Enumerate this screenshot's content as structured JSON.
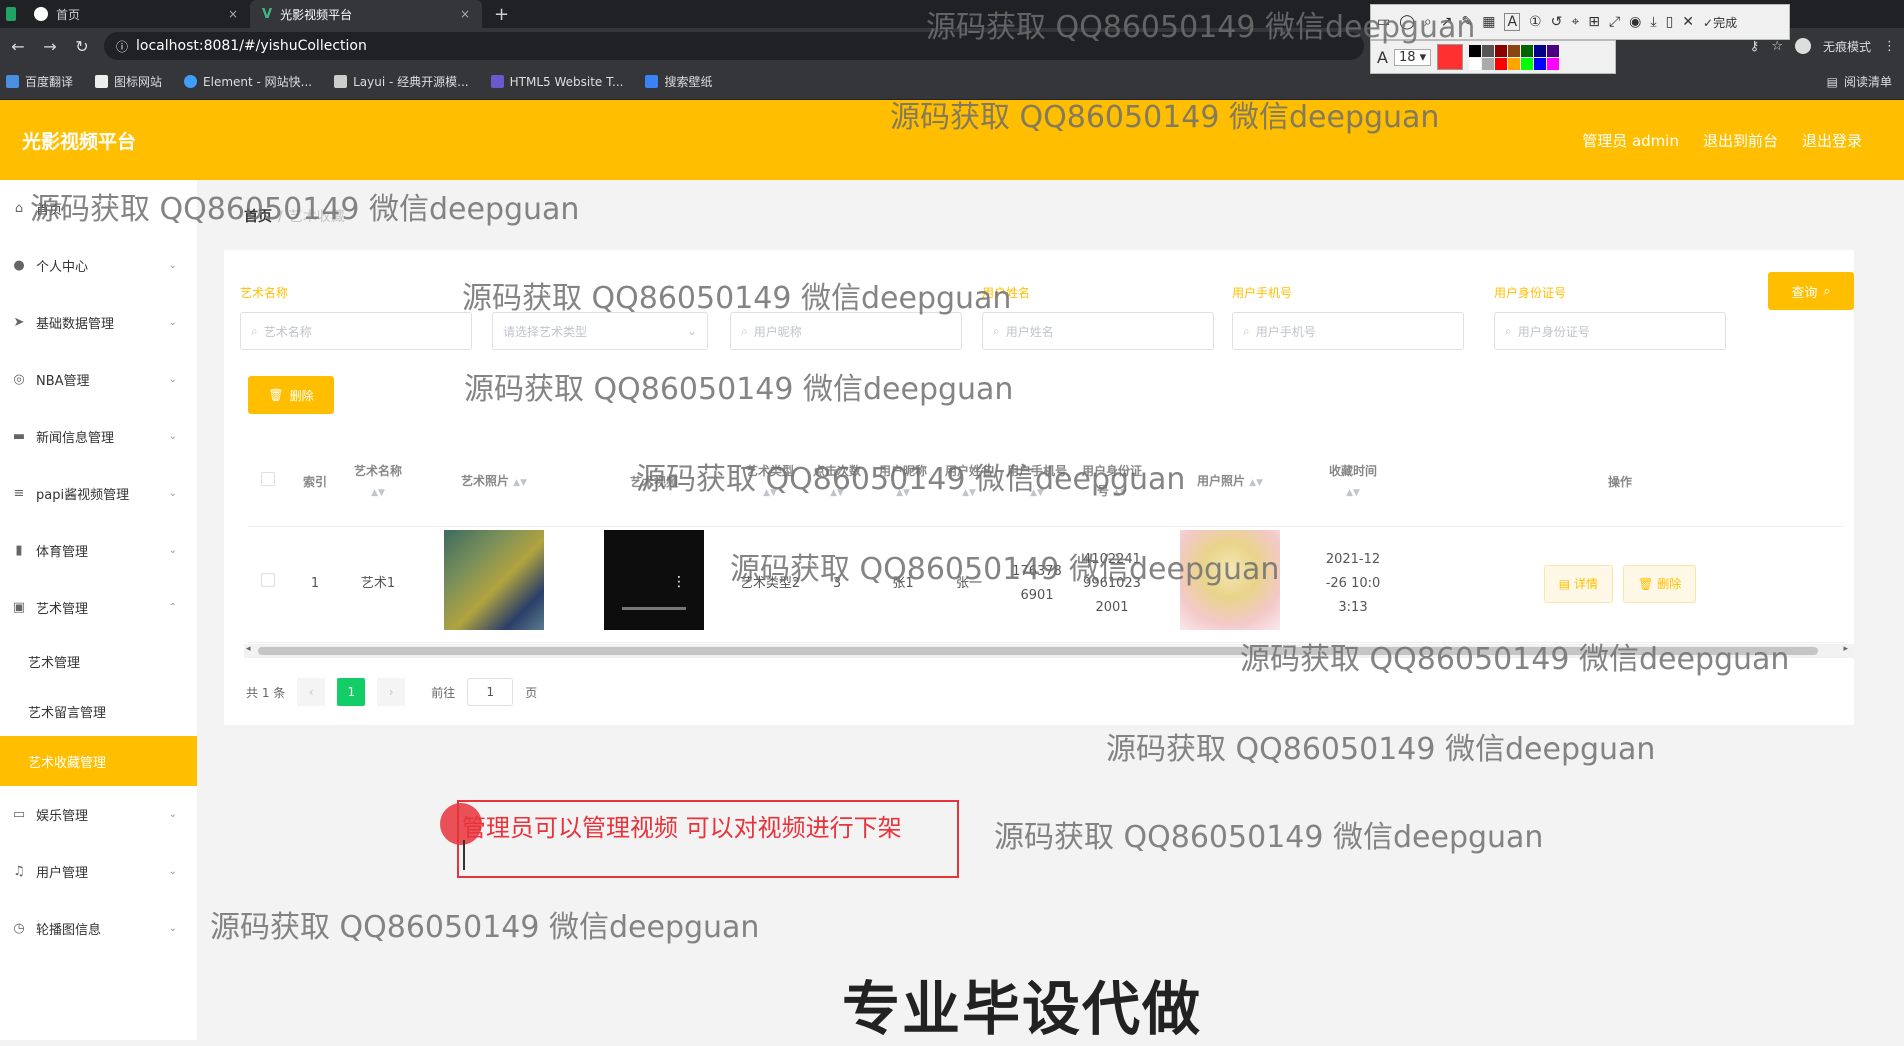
{
  "browser": {
    "tabs": [
      {
        "label": "首页",
        "close": "×"
      },
      {
        "label": "光影视频平台",
        "close": "×"
      }
    ],
    "new_tab": "+",
    "url": "localhost:8081/#/yishuCollection",
    "incognito_label": "无痕模式",
    "bookmarks": [
      "百度翻译",
      "图标网站",
      "Element - 网站快...",
      "Layui - 经典开源模...",
      "HTML5 Website T...",
      "搜索壁纸"
    ],
    "reading_list": "阅读清单"
  },
  "annotation_tool": {
    "font_size": "18",
    "done_label": "完成",
    "current_color": "#ff3030",
    "swatch_colors": [
      "#000000",
      "#555555",
      "#8b0000",
      "#8b4513",
      "#006400",
      "#00008b",
      "#4b0082",
      "#ffffff",
      "#aaaaaa",
      "#ff0000",
      "#ffa500",
      "#00ff00",
      "#0000ff",
      "#ff00ff",
      "#ffff00",
      "#00ffff"
    ]
  },
  "app": {
    "title": "光影视频平台",
    "nav": [
      "管理员 admin",
      "退出到前台",
      "退出登录"
    ],
    "accent": "#ffbf00"
  },
  "sidebar": {
    "items": [
      {
        "label": "首页",
        "icon": "home-icon"
      },
      {
        "label": "个人中心",
        "icon": "user-icon"
      },
      {
        "label": "基础数据管理",
        "icon": "send-icon"
      },
      {
        "label": "NBA管理",
        "icon": "circle-icon"
      },
      {
        "label": "新闻信息管理",
        "icon": "chat-icon"
      },
      {
        "label": "papi酱视频管理",
        "icon": "menu-icon"
      },
      {
        "label": "体育管理",
        "icon": "bar-icon"
      },
      {
        "label": "艺术管理",
        "icon": "box-icon"
      }
    ],
    "sub_items": [
      "艺术管理",
      "艺术留言管理",
      "艺术收藏管理"
    ],
    "items_after": [
      {
        "label": "娱乐管理",
        "icon": "chat-icon"
      },
      {
        "label": "用户管理",
        "icon": "mic-icon"
      },
      {
        "label": "轮播图信息",
        "icon": "clock-icon"
      }
    ]
  },
  "breadcrumb": {
    "home": "首页",
    "sep": "/",
    "current": "艺术收藏"
  },
  "filters": [
    {
      "label": "艺术名称",
      "placeholder": "艺术名称"
    },
    {
      "label": "",
      "placeholder": "请选择艺术类型"
    },
    {
      "label": "",
      "placeholder": "用户昵称"
    },
    {
      "label": "用户姓名",
      "placeholder": "用户姓名"
    },
    {
      "label": "用户手机号",
      "placeholder": "用户手机号"
    },
    {
      "label": "用户身份证号",
      "placeholder": "用户身份证号"
    }
  ],
  "buttons": {
    "search": "查询",
    "delete": "删除"
  },
  "table": {
    "headers": [
      "索引",
      "艺术名称",
      "艺术照片",
      "艺术视频",
      "艺术类型",
      "点击次数",
      "用户昵称",
      "用户姓名",
      "用户手机号",
      "用户身份证号",
      "用户照片",
      "收藏时间",
      "操作"
    ],
    "rows": [
      {
        "index": "1",
        "name": "艺术1",
        "type": "艺术类型2",
        "clicks": "3",
        "nickname": "张1",
        "realname": "张一",
        "phone": "176378 6901",
        "idcard": "4102241 9961023 2001",
        "time": "2021-12 -26 10:0 3:13",
        "detail_btn": "详情",
        "delete_btn": "删除"
      }
    ]
  },
  "pagination": {
    "total": "共 1 条",
    "prev": "‹",
    "page": "1",
    "next": "›",
    "goto_prefix": "前往",
    "goto_value": "1",
    "goto_suffix": "页"
  },
  "annotation": {
    "text": "管理员可以管理视频 可以对视频进行下架"
  },
  "watermark": "源码获取 QQ86050149 微信deepguan",
  "banner": "专业毕设代做"
}
